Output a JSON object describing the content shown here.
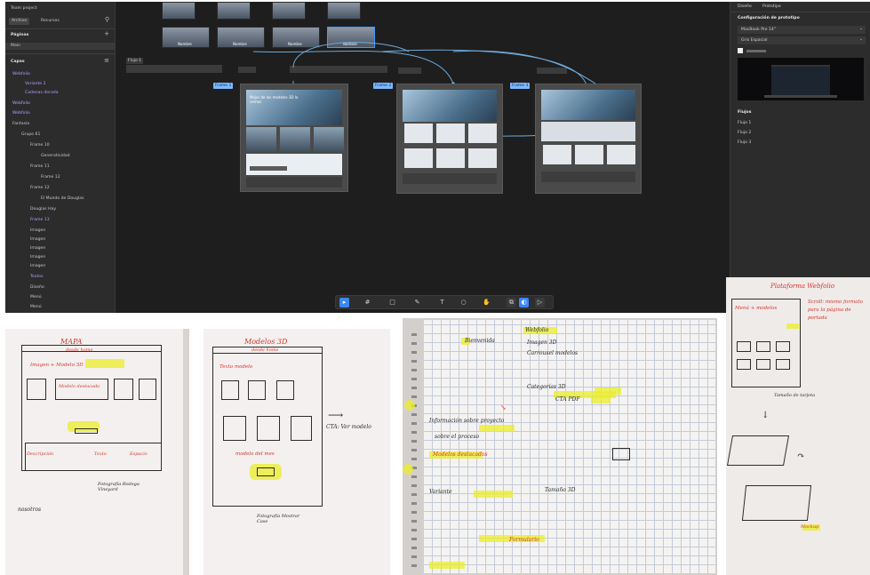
{
  "app": {
    "left_panel": {
      "project_title": "Team project",
      "tab_files": "Archivo",
      "tab_assets": "Recursos",
      "pages_header": "Páginas",
      "page_active": "Main",
      "layers_header": "Capas",
      "layers": [
        "Webfolio",
        "Variante 2",
        "Cadenas dorada",
        "Webfolio",
        "Webfolio",
        "Fantasía",
        "Grupo 61",
        "Frame 10",
        "Generatividad",
        "Frame 11",
        "Frame 12",
        "El Mundo de Douglas",
        "Douglas Hay",
        "Frame 13",
        "Imagen",
        "Imagen",
        "Imagen",
        "Imagen",
        "Imagen",
        "Textos",
        "Diseño",
        "Menú",
        "Menú"
      ]
    },
    "canvas": {
      "flow_label": "Flujo 1",
      "frame_labels": [
        "Frame 1",
        "Frame 2",
        "Frame 3"
      ],
      "hero_text": "Mejor de los modelos 3D lo vemos",
      "thumbs": [
        "Nombre",
        "Nombre",
        "Nombre",
        "Nombre"
      ],
      "toolbar_icons": [
        "move-icon",
        "frame-icon",
        "rectangle-icon",
        "pen-icon",
        "text-icon",
        "comment-icon",
        "hand-icon",
        "play-icon"
      ]
    },
    "right_panel": {
      "tab_design": "Diseño",
      "tab_prototype": "Prototipo",
      "section_title": "Configuración de prototipo",
      "device": "MacBook Pro 14\"",
      "color": "Gris Espacial",
      "flows_header": "Flujos",
      "flows": [
        "Flujo 1",
        "Flujo 2",
        "Flujo 3"
      ]
    }
  },
  "photos": {
    "sketch1": {
      "title": "MAPA",
      "subtitle": "desde home",
      "note": "Imagen + Modelo 3D",
      "hero": "Modelo destacado",
      "footer_labels": [
        "Descripción",
        "Texto",
        "Espacio"
      ],
      "caption": "Fotografía Bodega Vineyard",
      "margin_note": "nosotros"
    },
    "sketch2": {
      "title": "Modelos 3D",
      "subtitle": "desde home",
      "note": "Texto modelo",
      "mid_label": "modelo del mes",
      "arrow_label": "CTA: Ver modelo",
      "caption": "Fotografía Mostrar Case"
    },
    "notebook": {
      "header": "Webfolio",
      "lines": [
        "Bienvenida",
        "Imagen 3D",
        "Carrousel modelos",
        "Categorías 3D",
        "CTA PDF",
        "Información sobre proyecto",
        "sobre el proceso",
        "Modelos destacados",
        "Variante",
        "Tamaño 3D",
        "Formulario"
      ]
    },
    "sketch4": {
      "title": "Plataforma Webfolio",
      "note": "Menú + modelos",
      "side_note": "Scroll: mismo formato para la página de portada",
      "caption": "Tamaño de tarjeta",
      "bottom_note": "Mockup"
    }
  }
}
